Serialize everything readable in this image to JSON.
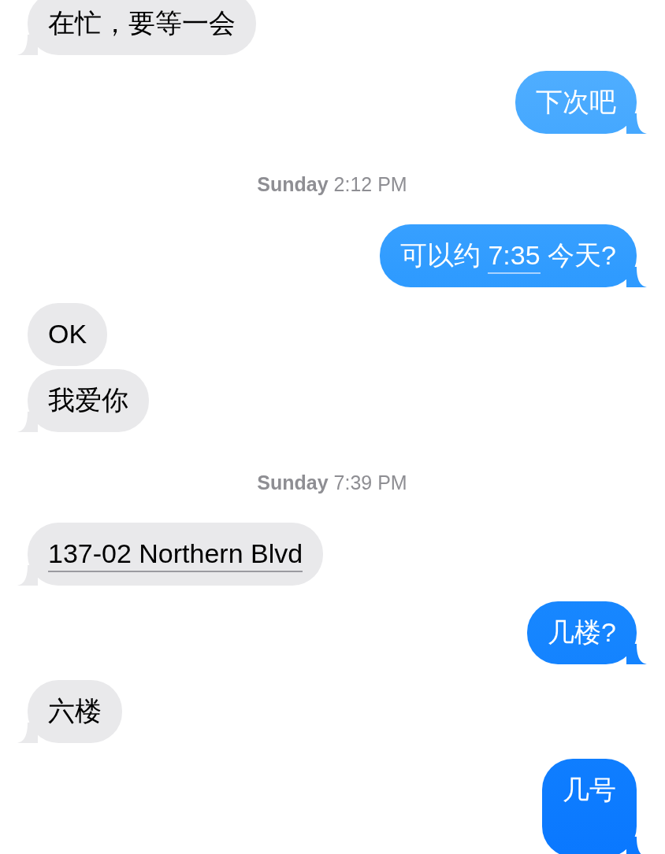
{
  "messages": [
    {
      "kind": "incoming",
      "tail": true,
      "parts": [
        {
          "text": "在忙，要等一会",
          "link": false
        }
      ]
    },
    {
      "kind": "outgoing",
      "tail": true,
      "parts": [
        {
          "text": "下次吧",
          "link": false
        }
      ]
    },
    {
      "kind": "timestamp",
      "text": "**Sunday** 2:12 PM"
    },
    {
      "kind": "outgoing",
      "tail": true,
      "parts": [
        {
          "text": "可以约 ",
          "link": false
        },
        {
          "text": "7:35",
          "link": true
        },
        {
          "text": " 今天?",
          "link": false
        }
      ]
    },
    {
      "kind": "incoming",
      "tail": false,
      "parts": [
        {
          "text": "OK",
          "link": false
        }
      ]
    },
    {
      "kind": "incoming",
      "tail": true,
      "parts": [
        {
          "text": "我爱你",
          "link": false
        }
      ]
    },
    {
      "kind": "timestamp",
      "text": "**Sunday** 7:39 PM"
    },
    {
      "kind": "incoming",
      "tail": true,
      "parts": [
        {
          "text": "137-02 Northern Blvd",
          "link": true
        }
      ]
    },
    {
      "kind": "outgoing",
      "tail": true,
      "parts": [
        {
          "text": "几楼?",
          "link": false
        }
      ]
    },
    {
      "kind": "incoming",
      "tail": true,
      "parts": [
        {
          "text": "六楼",
          "link": false
        }
      ]
    },
    {
      "kind": "outgoing",
      "tail": true,
      "parts": [
        {
          "text": "几号",
          "link": false
        }
      ]
    }
  ]
}
